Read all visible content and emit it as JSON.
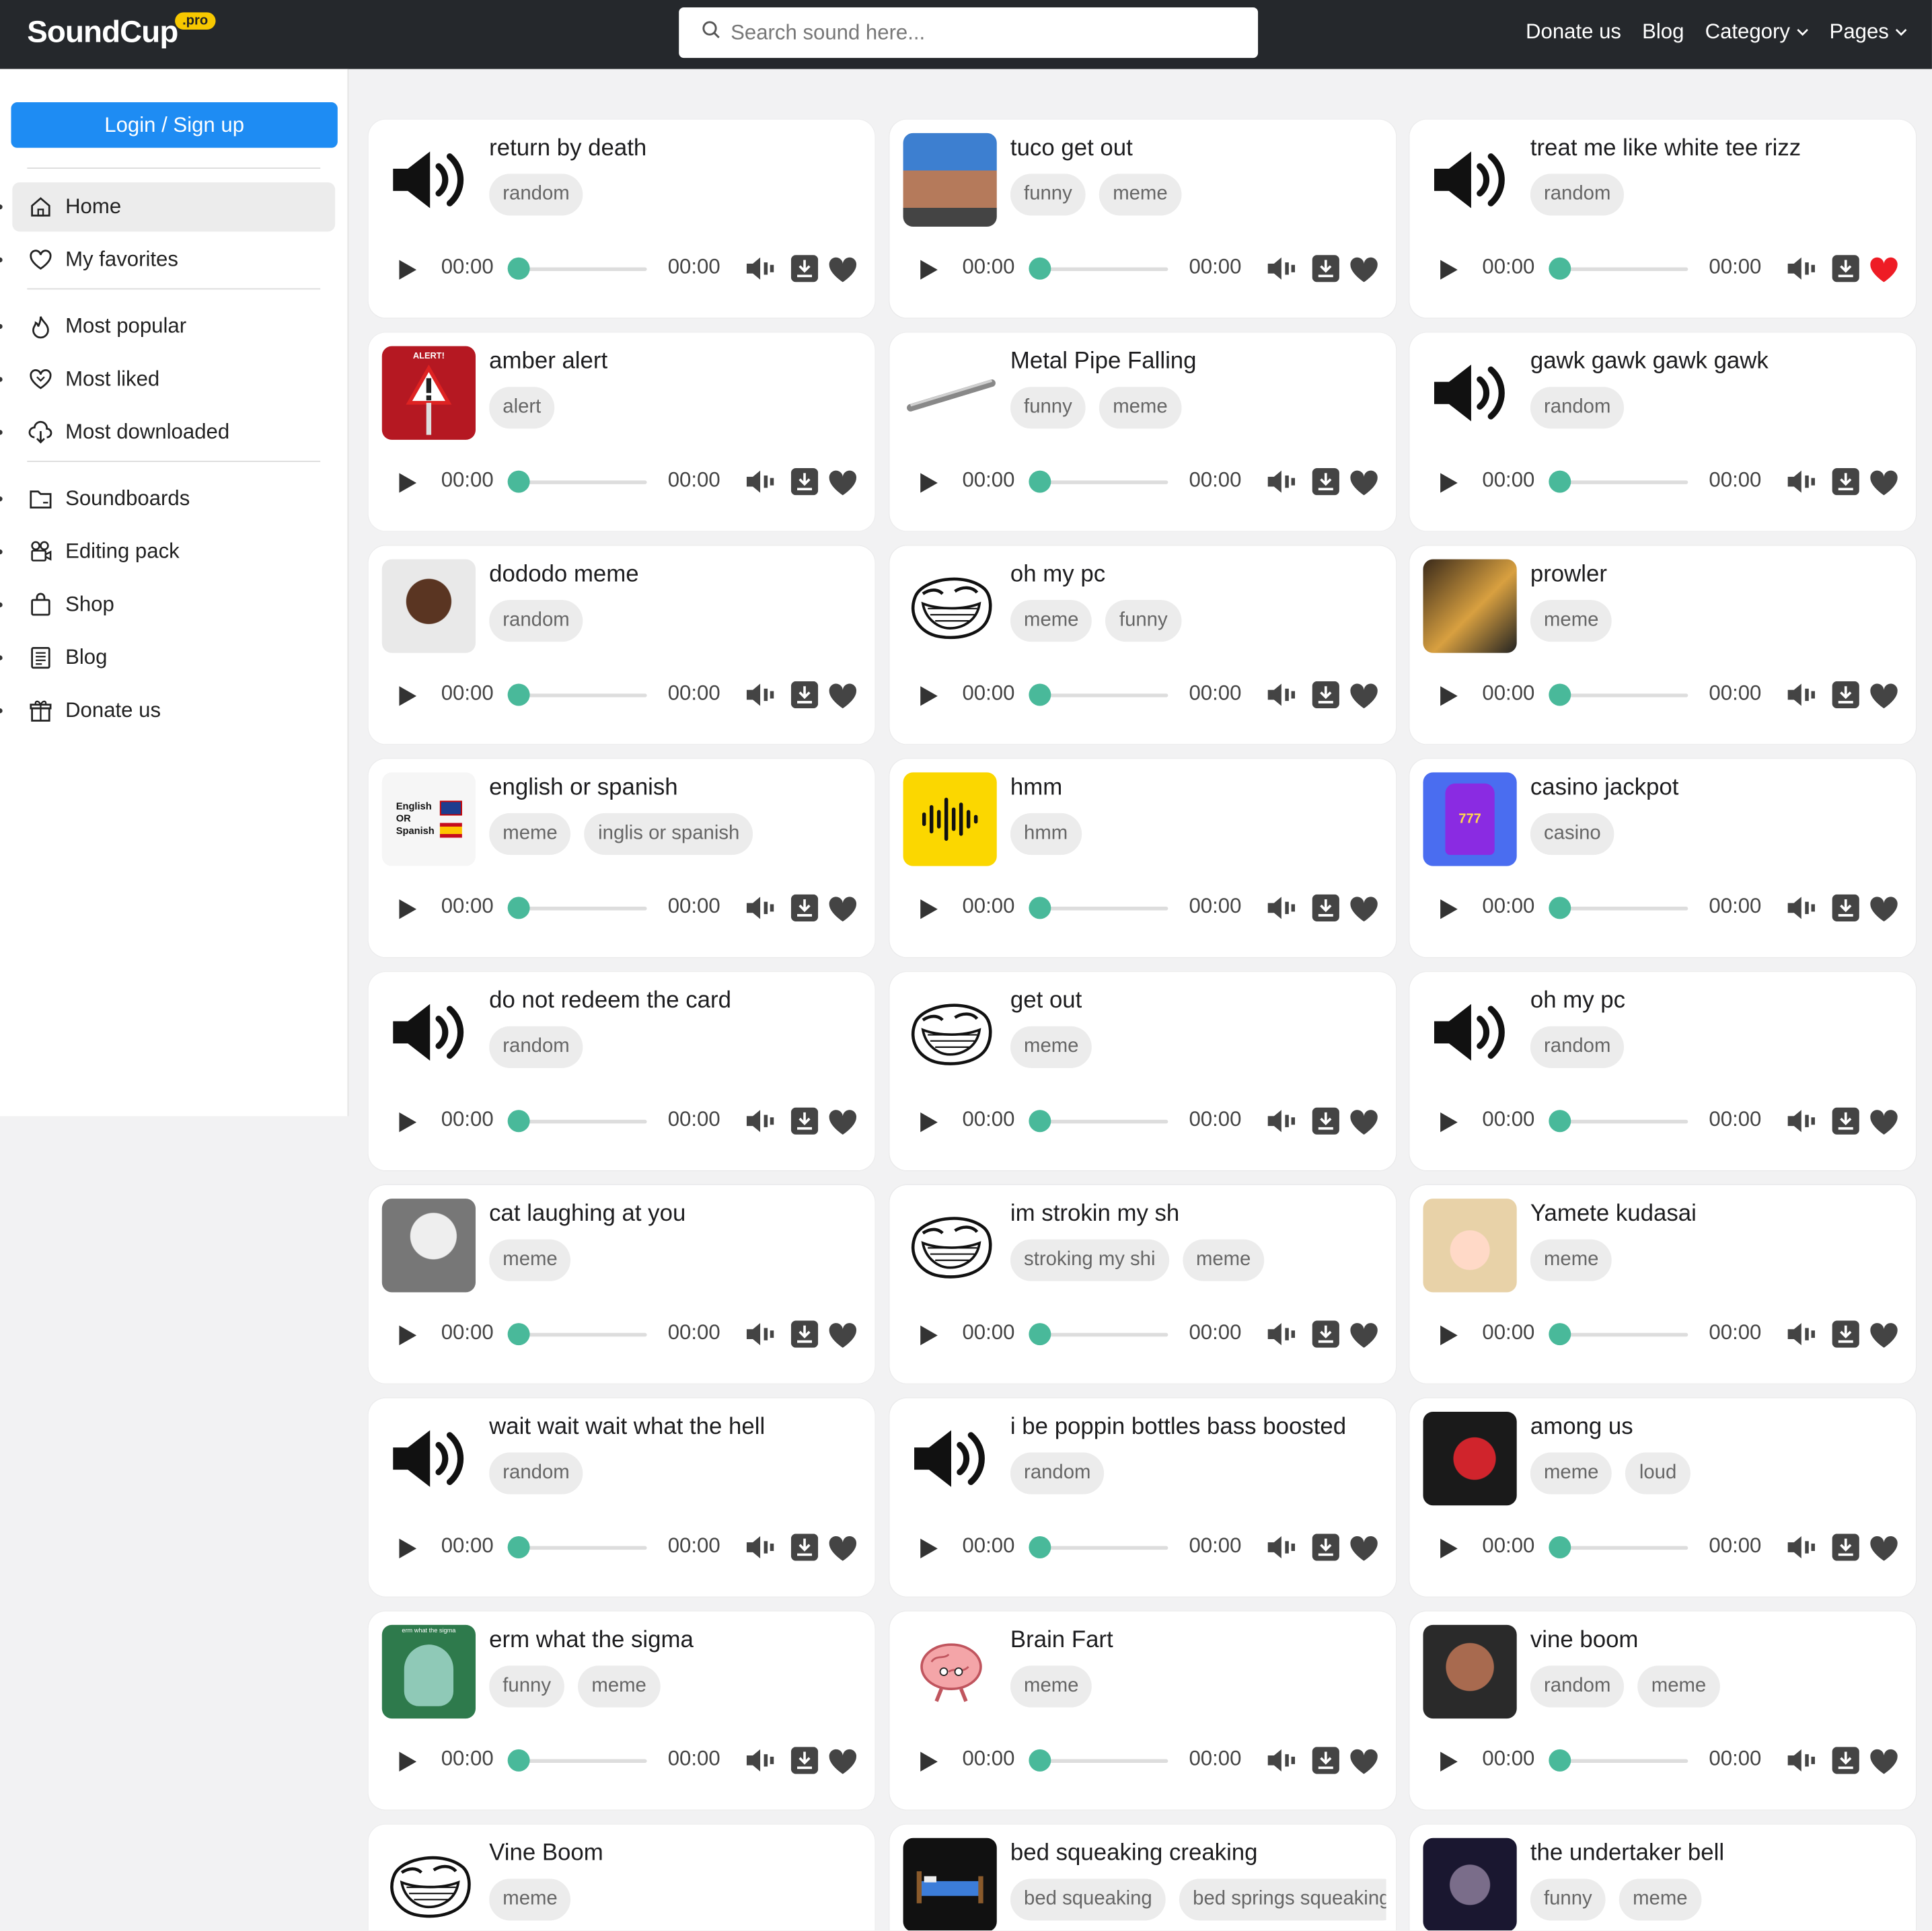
{
  "header": {
    "logo": "SoundCup",
    "logo_badge": ".pro",
    "search_placeholder": "Search sound here...",
    "nav": [
      "Donate us",
      "Blog",
      "Category",
      "Pages"
    ]
  },
  "sidebar": {
    "login_label": "Login / Sign up",
    "items": [
      {
        "label": "Home",
        "icon": "home-icon",
        "active": true
      },
      {
        "label": "My favorites",
        "icon": "heart-icon"
      },
      {
        "label": "Most popular",
        "icon": "fire-icon"
      },
      {
        "label": "Most liked",
        "icon": "hearts-icon"
      },
      {
        "label": "Most downloaded",
        "icon": "cloud-download-icon"
      },
      {
        "label": "Soundboards",
        "icon": "folder-icon"
      },
      {
        "label": "Editing pack",
        "icon": "film-icon"
      },
      {
        "label": "Shop",
        "icon": "bag-icon"
      },
      {
        "label": "Blog",
        "icon": "document-icon"
      },
      {
        "label": "Donate us",
        "icon": "gift-icon"
      }
    ]
  },
  "time_start": "00:00",
  "time_end": "00:00",
  "colors": {
    "accent": "#1e8cf3",
    "knob": "#49b99a",
    "liked": "#ee1c25",
    "topbar": "#25282c"
  },
  "sounds": [
    {
      "title": "return by death",
      "tags": [
        "random"
      ],
      "thumb": "speaker-icon"
    },
    {
      "title": "tuco get out",
      "tags": [
        "funny",
        "meme"
      ],
      "thumb": "tuco-image"
    },
    {
      "title": "treat me like white tee rizz",
      "tags": [
        "random"
      ],
      "thumb": "speaker-icon",
      "liked": true
    },
    {
      "title": "amber alert",
      "tags": [
        "alert"
      ],
      "thumb": "alert-sign-image",
      "thumb_text": "ALERT!"
    },
    {
      "title": "Metal Pipe Falling",
      "tags": [
        "funny",
        "meme"
      ],
      "thumb": "metal-pipe-image"
    },
    {
      "title": "gawk gawk gawk gawk",
      "tags": [
        "random"
      ],
      "thumb": "speaker-icon"
    },
    {
      "title": "dododo meme",
      "tags": [
        "random"
      ],
      "thumb": "face-image"
    },
    {
      "title": "oh my pc",
      "tags": [
        "meme",
        "funny"
      ],
      "thumb": "trollface-image"
    },
    {
      "title": "prowler",
      "tags": [
        "meme"
      ],
      "thumb": "anime-fighter-image"
    },
    {
      "title": "english or spanish",
      "tags": [
        "meme",
        "inglis or spanish"
      ],
      "thumb": "flags-image",
      "thumb_lines": [
        "English",
        "OR",
        "Spanish"
      ]
    },
    {
      "title": "hmm",
      "tags": [
        "hmm"
      ],
      "thumb": "waveform-image"
    },
    {
      "title": "casino jackpot",
      "tags": [
        "casino"
      ],
      "thumb": "slot-machine-image",
      "thumb_text": "777"
    },
    {
      "title": "do not redeem the card",
      "tags": [
        "random"
      ],
      "thumb": "speaker-icon"
    },
    {
      "title": "get out",
      "tags": [
        "meme"
      ],
      "thumb": "trollface-image"
    },
    {
      "title": "oh my pc",
      "tags": [
        "random"
      ],
      "thumb": "speaker-icon"
    },
    {
      "title": "cat laughing at you",
      "tags": [
        "meme"
      ],
      "thumb": "cat-image"
    },
    {
      "title": "im strokin my sh",
      "tags": [
        "stroking my shi",
        "meme"
      ],
      "thumb": "trollface-image"
    },
    {
      "title": "Yamete kudasai",
      "tags": [
        "meme"
      ],
      "thumb": "anime-girl-image"
    },
    {
      "title": "wait wait wait what the hell",
      "tags": [
        "random"
      ],
      "thumb": "speaker-icon"
    },
    {
      "title": "i be poppin bottles bass boosted",
      "tags": [
        "random"
      ],
      "thumb": "speaker-icon"
    },
    {
      "title": "among us",
      "tags": [
        "meme",
        "loud"
      ],
      "thumb": "among-us-image"
    },
    {
      "title": "erm what the sigma",
      "tags": [
        "funny",
        "meme"
      ],
      "thumb": "squidward-image",
      "thumb_text": "erm what the sigma"
    },
    {
      "title": "Brain Fart",
      "tags": [
        "meme"
      ],
      "thumb": "brain-image"
    },
    {
      "title": "vine boom",
      "tags": [
        "random",
        "meme"
      ],
      "thumb": "rock-face-image"
    },
    {
      "title": "Vine Boom",
      "tags": [
        "meme"
      ],
      "thumb": "trollface-image"
    },
    {
      "title": "bed squeaking creaking",
      "tags": [
        "bed squeaking",
        "bed springs squeaking"
      ],
      "thumb": "bed-image"
    },
    {
      "title": "the undertaker bell",
      "tags": [
        "funny",
        "meme"
      ],
      "thumb": "undertaker-image"
    }
  ]
}
